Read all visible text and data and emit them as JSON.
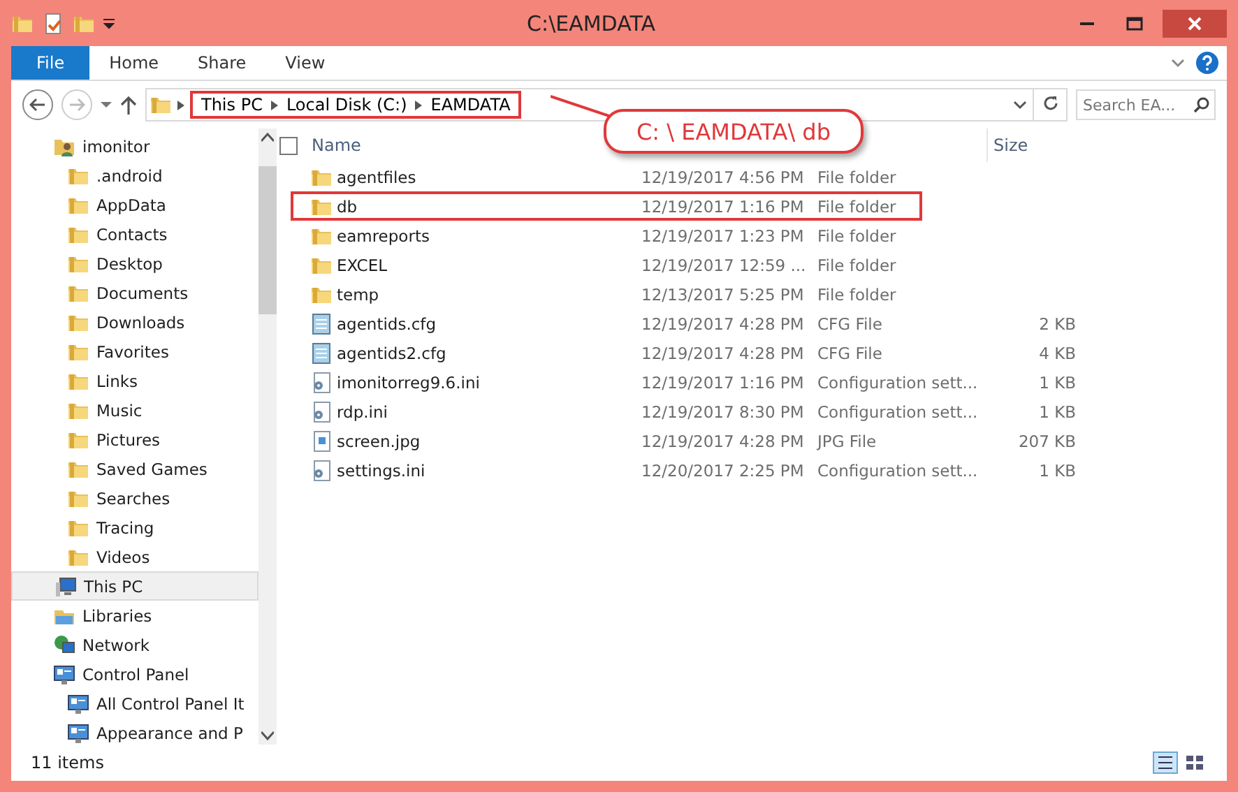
{
  "window": {
    "title": "C:\\EAMDATA"
  },
  "ribbon": {
    "file_tab": "File",
    "tabs": [
      {
        "label": "Home",
        "selected": false
      },
      {
        "label": "Share",
        "selected": false
      },
      {
        "label": "View",
        "selected": false
      }
    ]
  },
  "address": {
    "crumbs": [
      "This PC",
      "Local Disk (C:)",
      "EAMDATA"
    ],
    "annotated": true
  },
  "search": {
    "placeholder": "Search EA..."
  },
  "callout": {
    "text": "C: \\ EAMDATA\\ db"
  },
  "navigation": [
    {
      "label": "imonitor",
      "kind": "user",
      "selected": false,
      "children": [
        {
          "label": ".android",
          "kind": "folder",
          "selected": false
        },
        {
          "label": "AppData",
          "kind": "folder",
          "selected": false
        },
        {
          "label": "Contacts",
          "kind": "folder",
          "selected": false
        },
        {
          "label": "Desktop",
          "kind": "folder",
          "selected": false
        },
        {
          "label": "Documents",
          "kind": "folder",
          "selected": false
        },
        {
          "label": "Downloads",
          "kind": "folder",
          "selected": false
        },
        {
          "label": "Favorites",
          "kind": "folder",
          "selected": false
        },
        {
          "label": "Links",
          "kind": "folder",
          "selected": false
        },
        {
          "label": "Music",
          "kind": "folder",
          "selected": false
        },
        {
          "label": "Pictures",
          "kind": "folder",
          "selected": false
        },
        {
          "label": "Saved Games",
          "kind": "folder",
          "selected": false
        },
        {
          "label": "Searches",
          "kind": "folder",
          "selected": false
        },
        {
          "label": "Tracing",
          "kind": "folder",
          "selected": false
        },
        {
          "label": "Videos",
          "kind": "folder",
          "selected": false
        }
      ]
    },
    {
      "label": "This PC",
      "kind": "pc",
      "selected": true
    },
    {
      "label": "Libraries",
      "kind": "library",
      "selected": false
    },
    {
      "label": "Network",
      "kind": "network",
      "selected": false
    },
    {
      "label": "Control Panel",
      "kind": "panel",
      "selected": false,
      "children": [
        {
          "label": "All Control Panel It",
          "kind": "panel",
          "selected": false
        },
        {
          "label": "Appearance and P",
          "kind": "panel",
          "selected": false
        }
      ]
    }
  ],
  "table": {
    "select_all_checked": false,
    "columns": [
      "Name",
      "Size"
    ],
    "rows": [
      {
        "name": "agentfiles",
        "date": "12/19/2017 4:56 PM",
        "type": "File folder",
        "kind": "folder",
        "annotated": false
      },
      {
        "name": "db",
        "date": "12/19/2017 1:16 PM",
        "type": "File folder",
        "kind": "folder",
        "annotated": true
      },
      {
        "name": "eamreports",
        "date": "12/19/2017 1:23 PM",
        "type": "File folder",
        "kind": "folder",
        "annotated": false
      },
      {
        "name": "EXCEL",
        "date": "12/19/2017 12:59 ...",
        "type": "File folder",
        "kind": "folder",
        "annotated": false
      },
      {
        "name": "temp",
        "date": "12/13/2017 5:25 PM",
        "type": "File folder",
        "kind": "folder",
        "annotated": false
      },
      {
        "name": "agentids.cfg",
        "date": "12/19/2017 4:28 PM",
        "type": "CFG File",
        "size": "2 KB",
        "kind": "cfg",
        "annotated": false
      },
      {
        "name": "agentids2.cfg",
        "date": "12/19/2017 4:28 PM",
        "type": "CFG File",
        "size": "4 KB",
        "kind": "cfg",
        "annotated": false
      },
      {
        "name": "imonitorreg9.6.ini",
        "date": "12/19/2017 1:16 PM",
        "type": "Configuration sett...",
        "size": "1 KB",
        "kind": "ini",
        "annotated": false
      },
      {
        "name": "rdp.ini",
        "date": "12/19/2017 8:30 PM",
        "type": "Configuration sett...",
        "size": "1 KB",
        "kind": "ini",
        "annotated": false
      },
      {
        "name": "screen.jpg",
        "date": "12/19/2017 4:28 PM",
        "type": "JPG File",
        "size": "207 KB",
        "kind": "jpg",
        "annotated": false
      },
      {
        "name": "settings.ini",
        "date": "12/20/2017 2:25 PM",
        "type": "Configuration sett...",
        "size": "1 KB",
        "kind": "ini",
        "annotated": false
      }
    ]
  },
  "status_bar": {
    "items": "11 items"
  }
}
